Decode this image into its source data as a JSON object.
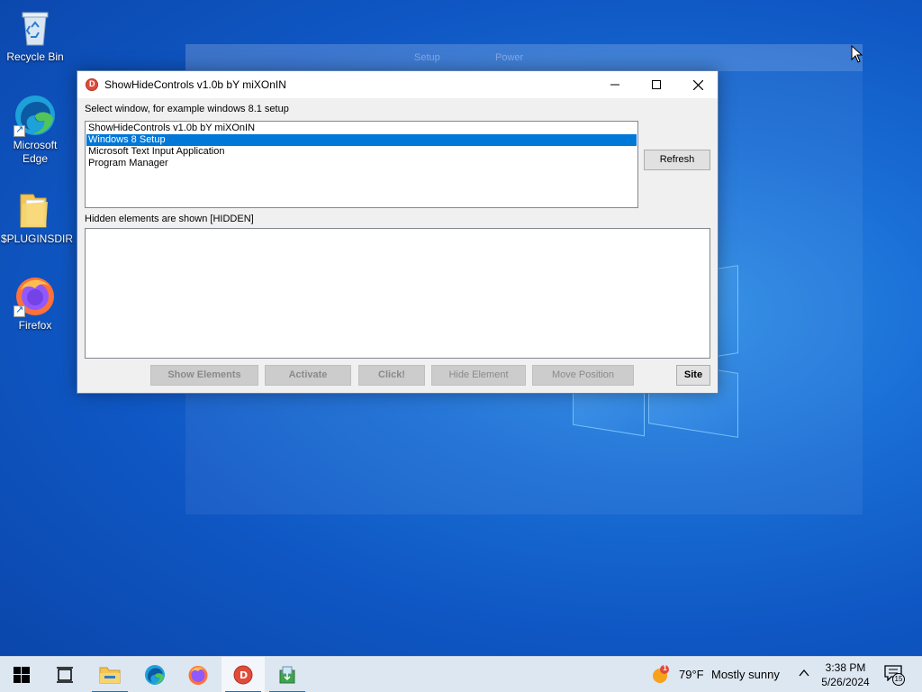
{
  "desktop": {
    "icons": [
      {
        "label": "Recycle Bin"
      },
      {
        "label": "Microsoft Edge"
      },
      {
        "label": "$PLUGINSDIR"
      },
      {
        "label": "Firefox"
      }
    ],
    "ghost_window": {
      "tab1": "Setup",
      "tab2": "Power"
    }
  },
  "window": {
    "title": "ShowHideControls v1.0b bY miXOnIN",
    "select_label": "Select window, for example windows 8.1 setup",
    "list_items": [
      {
        "label": "ShowHideControls v1.0b bY miXOnIN",
        "selected": false
      },
      {
        "label": "Windows 8 Setup",
        "selected": true
      },
      {
        "label": "Microsoft Text Input Application",
        "selected": false
      },
      {
        "label": "Program Manager",
        "selected": false
      }
    ],
    "refresh_label": "Refresh",
    "hidden_label": "Hidden elements are shown [HIDDEN]",
    "buttons": {
      "show_elements": "Show Elements",
      "activate": "Activate",
      "click": "Click!",
      "hide_element": "Hide Element",
      "move_position": "Move Position",
      "site": "Site"
    }
  },
  "taskbar": {
    "weather_temp": "79°F",
    "weather_desc": "Mostly sunny",
    "weather_badge": "1",
    "time": "3:38 PM",
    "date": "5/26/2024",
    "notification_count": "15"
  },
  "colors": {
    "accent": "#0078d7",
    "desktop": "#0f57c4"
  }
}
